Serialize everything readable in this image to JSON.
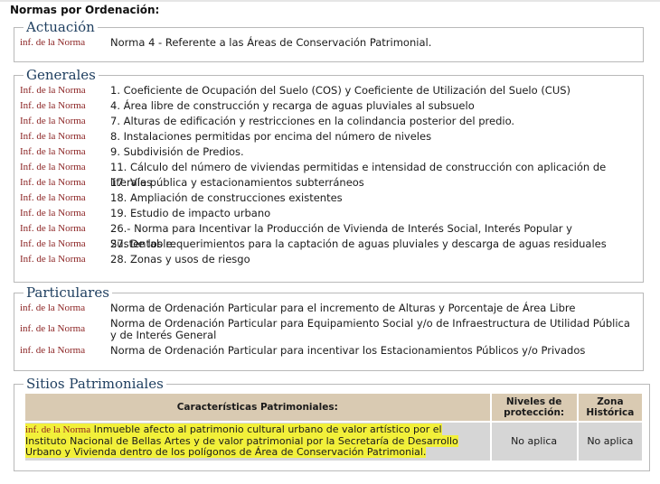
{
  "title": "Normas por Ordenación:",
  "link_label": "inf. de la Norma",
  "link_label_cap": "Inf. de la Norma",
  "sections": {
    "actuacion": {
      "legend": "Actuación",
      "items": [
        {
          "text": "Norma 4 - Referente a las Áreas de Conservación Patrimonial."
        }
      ]
    },
    "generales": {
      "legend": "Generales",
      "items": [
        {
          "text": "1. Coeficiente de Ocupación del Suelo (COS) y Coeficiente de Utilización del Suelo (CUS)"
        },
        {
          "text": "4. Área libre de construcción y recarga de aguas pluviales al subsuelo"
        },
        {
          "text": "7. Alturas de edificación y restricciones en la colindancia posterior del predio."
        },
        {
          "text": "8. Instalaciones permitidas por encima del número de niveles"
        },
        {
          "text": "9. Subdivisión de Predios."
        },
        {
          "text": "11. Cálculo del número de viviendas permitidas e intensidad de construcción con aplicación de literales"
        },
        {
          "text": "17. Vía pública y estacionamientos subterráneos"
        },
        {
          "text": "18. Ampliación de construcciones existentes"
        },
        {
          "text": "19. Estudio de impacto urbano"
        },
        {
          "text": "26.- Norma para Incentivar la Producción de Vivienda de Interés Social, Interés Popular y Sustentable."
        },
        {
          "text": "27. De los requerimientos para la captación de aguas pluviales y descarga de aguas residuales"
        },
        {
          "text": "28. Zonas y usos de riesgo"
        }
      ]
    },
    "particulares": {
      "legend": "Particulares",
      "items": [
        {
          "text": "Norma de Ordenación Particular para el incremento de Alturas y Porcentaje de Área Libre"
        },
        {
          "text": "Norma de Ordenación Particular para Equipamiento Social y/o de Infraestructura de Utilidad Pública y de Interés General"
        },
        {
          "text": "Norma de Ordenación Particular para incentivar los Estacionamientos Públicos y/o Privados"
        }
      ]
    },
    "sitios": {
      "legend": "Sitios Patrimoniales",
      "headers": {
        "caracteristicas": "Características Patrimoniales:",
        "niveles": "Niveles de protección:",
        "zona": "Zona Histórica"
      },
      "row": {
        "link": "inf. de la Norma",
        "description": "Inmueble afecto al patrimonio cultural urbano de valor artístico por el Instituto Nacional de Bellas Artes y de valor patrimonial por la Secretaría de Desarrollo Urbano y Vivienda dentro de los polígonos de Área de Conservación Patrimonial.",
        "niveles": "No aplica",
        "zona": "No aplica"
      }
    }
  },
  "colors": {
    "link": "#8b2323",
    "legend": "#1f3f60",
    "table_header": "#d9cab2",
    "table_cell": "#d6d6d6",
    "highlight": "#f2f03a"
  }
}
